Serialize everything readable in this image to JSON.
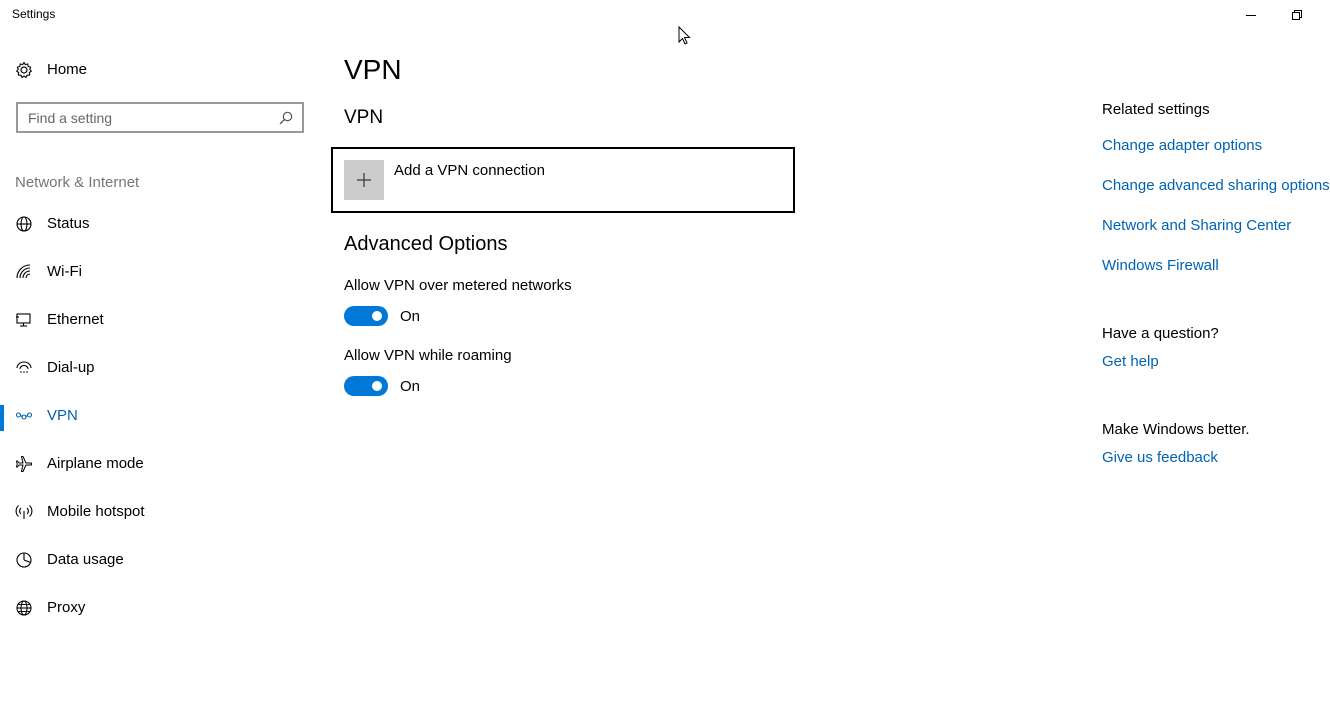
{
  "window": {
    "title": "Settings"
  },
  "nav": {
    "home_label": "Home",
    "search_placeholder": "Find a setting",
    "section_label": "Network & Internet",
    "items": [
      {
        "label": "Status",
        "icon": "globe-status-icon"
      },
      {
        "label": "Wi-Fi",
        "icon": "wifi-icon"
      },
      {
        "label": "Ethernet",
        "icon": "ethernet-icon"
      },
      {
        "label": "Dial-up",
        "icon": "dialup-icon"
      },
      {
        "label": "VPN",
        "icon": "vpn-icon",
        "active": true
      },
      {
        "label": "Airplane mode",
        "icon": "airplane-icon"
      },
      {
        "label": "Mobile hotspot",
        "icon": "hotspot-icon"
      },
      {
        "label": "Data usage",
        "icon": "data-usage-icon"
      },
      {
        "label": "Proxy",
        "icon": "proxy-globe-icon"
      }
    ]
  },
  "main": {
    "page_title": "VPN",
    "section_title": "VPN",
    "add_vpn_label": "Add a VPN connection",
    "advanced_title": "Advanced Options",
    "options": [
      {
        "label": "Allow VPN over metered networks",
        "state": "On",
        "enabled": true
      },
      {
        "label": "Allow VPN while roaming",
        "state": "On",
        "enabled": true
      }
    ]
  },
  "side": {
    "related_heading": "Related settings",
    "related_links": [
      "Change adapter options",
      "Change advanced sharing options",
      "Network and Sharing Center",
      "Windows Firewall"
    ],
    "question_heading": "Have a question?",
    "help_link": "Get help",
    "feedback_heading": "Make Windows better.",
    "feedback_link": "Give us feedback"
  },
  "colors": {
    "accent": "#0078d7",
    "link": "#0063b1",
    "muted": "#767676"
  }
}
